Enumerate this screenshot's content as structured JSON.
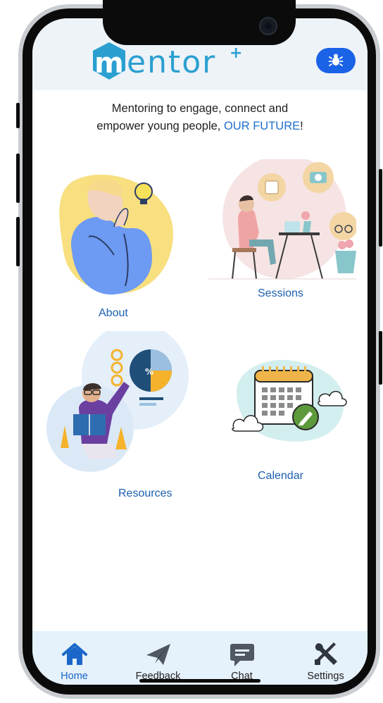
{
  "header": {
    "logo_text": "mentor",
    "logo_plus": "+"
  },
  "tagline": {
    "line1": "Mentoring to engage, connect and",
    "line2_prefix": "empower young people, ",
    "highlight": "OUR FUTURE",
    "line2_suffix": "!"
  },
  "tiles": [
    {
      "label": "About",
      "icon": "thinking-person-illustration"
    },
    {
      "label": "Sessions",
      "icon": "person-at-desk-illustration"
    },
    {
      "label": "Resources",
      "icon": "reading-person-charts-illustration"
    },
    {
      "label": "Calendar",
      "icon": "calendar-clouds-illustration"
    }
  ],
  "tabs": [
    {
      "label": "Home",
      "icon": "home-icon",
      "active": true
    },
    {
      "label": "Feedback",
      "icon": "paper-plane-icon",
      "active": false
    },
    {
      "label": "Chat",
      "icon": "chat-bubble-icon",
      "active": false
    },
    {
      "label": "Settings",
      "icon": "wrench-screwdriver-icon",
      "active": false
    }
  ],
  "colors": {
    "accent": "#1a67c9",
    "tabbar_bg": "#e5f1fb",
    "bug_button": "#1a62e6",
    "logo": "#2b9fd0"
  }
}
